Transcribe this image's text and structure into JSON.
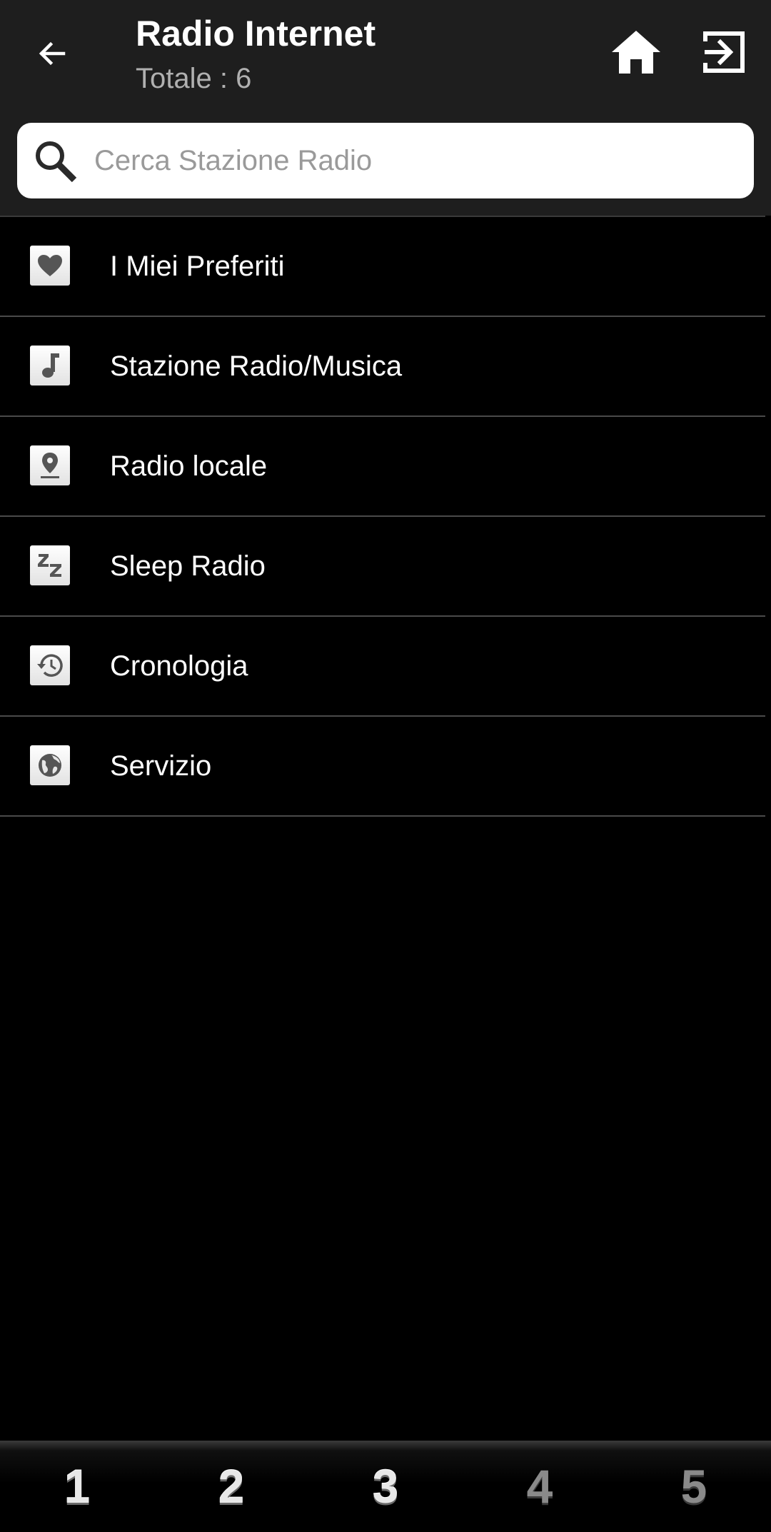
{
  "header": {
    "title": "Radio Internet",
    "subtitle": "Totale : 6",
    "back_icon": "arrow-left-icon",
    "home_icon": "home-icon",
    "exit_icon": "exit-icon",
    "background_color": "#1e1e1e"
  },
  "search": {
    "placeholder": "Cerca Stazione Radio",
    "value": "",
    "icon": "search-icon"
  },
  "menu": {
    "items": [
      {
        "label": "I Miei Preferiti",
        "icon": "heart-icon"
      },
      {
        "label": "Stazione Radio/Musica",
        "icon": "music-note-icon"
      },
      {
        "label": "Radio locale",
        "icon": "location-pin-icon"
      },
      {
        "label": "Sleep Radio",
        "icon": "sleep-zzz-icon"
      },
      {
        "label": "Cronologia",
        "icon": "history-icon"
      },
      {
        "label": "Servizio",
        "icon": "globe-icon"
      }
    ]
  },
  "bottom_bar": {
    "buttons": [
      {
        "label": "1",
        "state": "active"
      },
      {
        "label": "2",
        "state": "active"
      },
      {
        "label": "3",
        "state": "active"
      },
      {
        "label": "4",
        "state": "inactive"
      },
      {
        "label": "5",
        "state": "inactive"
      }
    ]
  },
  "colors": {
    "background": "#000000",
    "divider": "#4a4a4a",
    "subtitle": "#b0b0b0",
    "placeholder": "#9a9a9a"
  }
}
